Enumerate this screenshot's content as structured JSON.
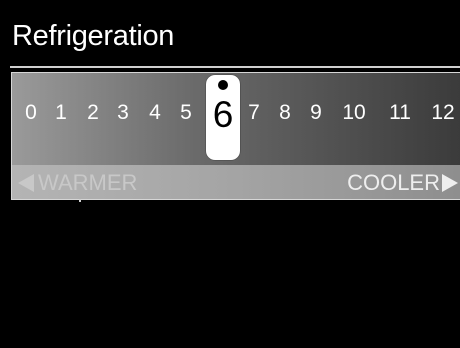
{
  "title": "Refrigeration",
  "scale": {
    "ticks": [
      "0",
      "1",
      "2",
      "3",
      "4",
      "5",
      "6",
      "7",
      "8",
      "9",
      "10",
      "11",
      "12"
    ],
    "selected_value": "6",
    "warmer_label": "WARMER",
    "cooler_label": "COOLER"
  },
  "colors": {
    "background": "#000000",
    "thumb": "#ffffff",
    "text": "#ffffff"
  },
  "icons": {
    "warmer": "triangle-left-icon",
    "cooler": "triangle-right-icon"
  }
}
